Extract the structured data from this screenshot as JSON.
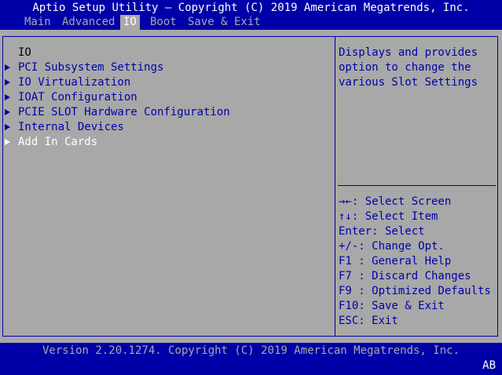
{
  "title": "Aptio Setup Utility – Copyright (C) 2019 American Megatrends, Inc.",
  "menu": {
    "main": "Main",
    "advanced": "Advanced",
    "io": "IO",
    "boot": "Boot",
    "save_exit": "Save & Exit"
  },
  "page_heading": "IO",
  "items": [
    {
      "label": "PCI Subsystem Settings"
    },
    {
      "label": "IO Virtualization"
    },
    {
      "label": "IOAT Configuration"
    },
    {
      "label": "PCIE SLOT Hardware Configuration"
    },
    {
      "label": "Internal Devices"
    },
    {
      "label": "Add In Cards"
    }
  ],
  "help_text": "Displays and provides\noption to change the\nvarious Slot Settings",
  "keys": [
    {
      "text": "→←: Select Screen"
    },
    {
      "text": "↑↓: Select Item"
    },
    {
      "text": "Enter: Select"
    },
    {
      "text": "+/-: Change Opt."
    },
    {
      "text": "F1 : General Help"
    },
    {
      "text": "F7 : Discard Changes"
    },
    {
      "text": "F9 : Optimized Defaults"
    },
    {
      "text": "F10: Save & Exit"
    },
    {
      "text": "ESC: Exit"
    }
  ],
  "footer": "Version 2.20.1274. Copyright (C) 2019 American Megatrends, Inc.",
  "corner": "AB",
  "colors": {
    "background": "#0000a8",
    "panel": "#a8a8a8",
    "text_blue": "#0000a8",
    "text_white": "#ffffff"
  }
}
